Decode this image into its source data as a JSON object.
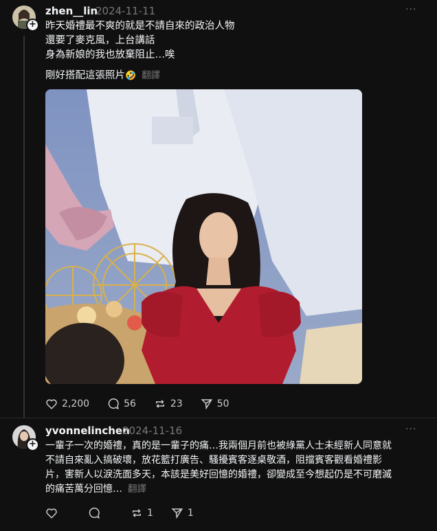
{
  "post1": {
    "username": "zhen__lin",
    "timestamp": "2024-11-11",
    "lines": [
      "昨天婚禮最不爽的就是不請自來的政治人物",
      "還要了麥克風，上台講話",
      "身為新娘的我也放棄阻止…唉"
    ],
    "caption": "剛好搭配這張照片",
    "caption_emoji": "🤣",
    "translate": "翻譯",
    "likes": "2,200",
    "comments": "56",
    "reposts": "23",
    "shares": "50"
  },
  "post2": {
    "username": "yvonnelinchen",
    "timestamp": "2024-11-16",
    "lines": [
      "一輩子一次的婚禮，真的是一輩子的痛…我兩個月前也被綠黨人士未經新人同意就",
      "不請自來亂入搞破壞，放花籃打廣告、騷擾賓客逐桌敬酒，阻擋賓客觀看婚禮影",
      "片，害新人以淚洗面多天，本該是美好回憶的婚禮，卻變成至今想起仍是不可磨滅",
      "的痛苦萬分回憶…"
    ],
    "translate": "翻譯",
    "reposts": "1",
    "shares": "1"
  },
  "more_label": "···",
  "colors": {
    "bg": "#101010",
    "text": "#f3f5f7",
    "muted": "#777777",
    "dress": "#b11d2e"
  }
}
